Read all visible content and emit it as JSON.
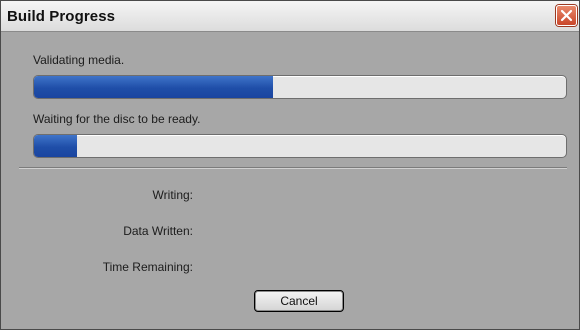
{
  "window": {
    "title": "Build Progress"
  },
  "progress": {
    "status1": "Validating media.",
    "bar1_value": 0.45,
    "status2": "Waiting for the disc to be ready.",
    "bar2_value": 0.08,
    "fill_color": "#1f4ea8"
  },
  "fields": {
    "writing_label": "Writing:",
    "data_written_label": "Data Written:",
    "time_remaining_label": "Time Remaining:"
  },
  "buttons": {
    "cancel_label": "Cancel"
  },
  "icons": {
    "close": "close-icon"
  }
}
